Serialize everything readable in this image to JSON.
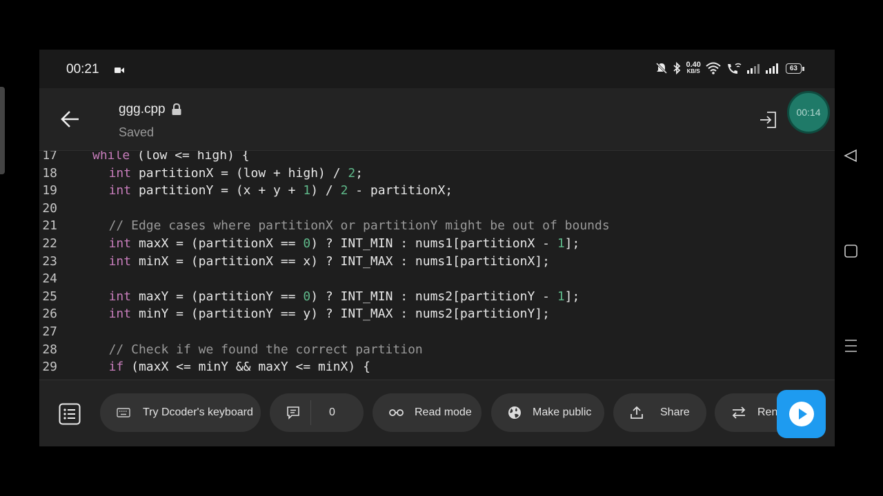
{
  "status": {
    "time": "00:21",
    "net_speed": "0.40",
    "net_unit": "KB/S",
    "battery": "63"
  },
  "header": {
    "filename": "ggg.cpp",
    "save_state": "Saved",
    "timer": "00:14"
  },
  "code_lines": [
    {
      "n": "17",
      "indent": 2,
      "tokens": [
        {
          "t": "while",
          "c": "kw"
        },
        {
          "t": " (low <= high) {"
        }
      ]
    },
    {
      "n": "18",
      "indent": 4,
      "tokens": [
        {
          "t": "int",
          "c": "kw"
        },
        {
          "t": " partitionX = (low + high) / "
        },
        {
          "t": "2",
          "c": "num"
        },
        {
          "t": ";"
        }
      ]
    },
    {
      "n": "19",
      "indent": 4,
      "tokens": [
        {
          "t": "int",
          "c": "kw"
        },
        {
          "t": " partitionY = (x + y + "
        },
        {
          "t": "1",
          "c": "num"
        },
        {
          "t": ") / "
        },
        {
          "t": "2",
          "c": "num"
        },
        {
          "t": " - partitionX;"
        }
      ]
    },
    {
      "n": "20",
      "indent": 0,
      "tokens": []
    },
    {
      "n": "21",
      "indent": 4,
      "tokens": [
        {
          "t": "// Edge cases where partitionX or partitionY might be out of bounds",
          "c": "cm"
        }
      ]
    },
    {
      "n": "22",
      "indent": 4,
      "tokens": [
        {
          "t": "int",
          "c": "kw"
        },
        {
          "t": " maxX = (partitionX == "
        },
        {
          "t": "0",
          "c": "num"
        },
        {
          "t": ") ? INT_MIN : nums1[partitionX - "
        },
        {
          "t": "1",
          "c": "num"
        },
        {
          "t": "];"
        }
      ]
    },
    {
      "n": "23",
      "indent": 4,
      "tokens": [
        {
          "t": "int",
          "c": "kw"
        },
        {
          "t": " minX = (partitionX == x) ? INT_MAX : nums1[partitionX];"
        }
      ]
    },
    {
      "n": "24",
      "indent": 0,
      "tokens": []
    },
    {
      "n": "25",
      "indent": 4,
      "tokens": [
        {
          "t": "int",
          "c": "kw"
        },
        {
          "t": " maxY = (partitionY == "
        },
        {
          "t": "0",
          "c": "num"
        },
        {
          "t": ") ? INT_MIN : nums2[partitionY - "
        },
        {
          "t": "1",
          "c": "num"
        },
        {
          "t": "];"
        }
      ]
    },
    {
      "n": "26",
      "indent": 4,
      "tokens": [
        {
          "t": "int",
          "c": "kw"
        },
        {
          "t": " minY = (partitionY == y) ? INT_MAX : nums2[partitionY];"
        }
      ]
    },
    {
      "n": "27",
      "indent": 0,
      "tokens": []
    },
    {
      "n": "28",
      "indent": 4,
      "tokens": [
        {
          "t": "// Check if we found the correct partition",
          "c": "cm"
        }
      ]
    },
    {
      "n": "29",
      "indent": 4,
      "tokens": [
        {
          "t": "if",
          "c": "kw"
        },
        {
          "t": " (maxX <= minY && maxY <= minX) {"
        }
      ]
    }
  ],
  "toolbar": {
    "keyboard_label": "Try Dcoder's keyboard",
    "comments_count": "0",
    "read_mode_label": "Read mode",
    "make_public_label": "Make public",
    "share_label": "Share",
    "rename_label": "Ren"
  },
  "colors": {
    "accent_run": "#1e9bf0",
    "timer": "#1f7a68",
    "keyword": "#c77dbb",
    "number": "#5fb98a"
  }
}
